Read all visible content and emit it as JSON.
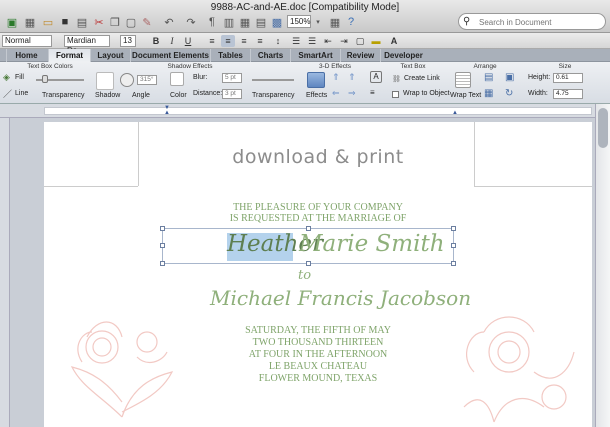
{
  "window": {
    "title": "9988-AC-and-AE.doc [Compatibility Mode]"
  },
  "toolbar": {
    "zoom": "150%",
    "icons": [
      "new-doc-icon",
      "templates-icon",
      "open-icon",
      "save-icon",
      "print-icon",
      "cut-icon",
      "copy-icon",
      "paste-icon",
      "format-painter-icon",
      "undo-icon",
      "redo-icon",
      "pilcrow-icon",
      "sidebar-icon",
      "table-icon",
      "columns-icon",
      "media-icon",
      "gallery-icon",
      "help-icon"
    ]
  },
  "search": {
    "placeholder": "Search in Document"
  },
  "formatting": {
    "style": "Normal",
    "font": "Mardian De...",
    "size": "13",
    "bold": "B",
    "italic": "I",
    "underline": "U"
  },
  "ribbon_tabs": [
    "Home",
    "Format",
    "Layout",
    "Document Elements",
    "Tables",
    "Charts",
    "SmartArt",
    "Review",
    "Developer"
  ],
  "ribbon": {
    "groups": [
      "Text Box Colors",
      "Shadow Effects",
      "3-D Effects",
      "Text Box",
      "Arrange",
      "Size"
    ],
    "fill": "Fill",
    "line": "Line",
    "transparency": "Transparency",
    "shadow": "Shadow",
    "angle_value": "315°",
    "angle": "Angle",
    "color": "Color",
    "blur": "Blur:",
    "blur_value": "5 pt",
    "distance": "Distance:",
    "distance_value": "3 pt",
    "shadow_transparency": "Transparency",
    "effects": "Effects",
    "create_link": "Create Link",
    "wrap_to_object": "Wrap to Object",
    "wrap_text": "Wrap Text",
    "height": "Height:",
    "height_value": "0.61",
    "width": "Width:",
    "width_value": "4.75"
  },
  "document": {
    "logo": "download & print",
    "line1": "THE PLEASURE OF YOUR COMPANY",
    "line2": "IS REQUESTED AT THE MARRIAGE OF",
    "bride_first": "Heather",
    "bride_rest": "Marie Smith",
    "to": "to",
    "groom": "Michael Francis Jacobson",
    "d1": "SATURDAY, THE FIFTH OF MAY",
    "d2": "TWO THOUSAND THIRTEEN",
    "d3": "AT FOUR IN THE AFTERNOON",
    "d4": "LE BEAUX CHATEAU",
    "d5": "FLOWER MOUND, TEXAS"
  },
  "colors": {
    "accent_green": "#7fa46a",
    "floral_pink": "#f2c9c4",
    "selection_blue": "#b4d2ec"
  }
}
